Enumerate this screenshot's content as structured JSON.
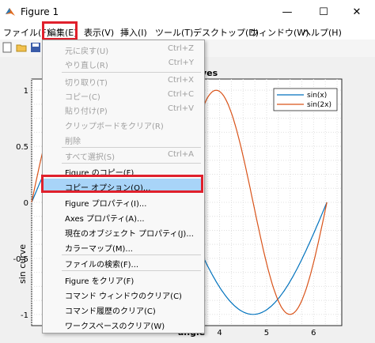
{
  "window": {
    "title": "Figure 1",
    "min_glyph": "—",
    "max_glyph": "☐",
    "close_glyph": "✕"
  },
  "menubar": [
    {
      "label": "ファイル(F)"
    },
    {
      "label": "編集(E)"
    },
    {
      "label": "表示(V)"
    },
    {
      "label": "挿入(I)"
    },
    {
      "label": "ツール(T)"
    },
    {
      "label": "デスクトップ(D)"
    },
    {
      "label": "ウィンドウ(W)"
    },
    {
      "label": "ヘルプ(H)"
    }
  ],
  "edit_menu": {
    "items": [
      {
        "label": "元に戻す(U)",
        "shortcut": "Ctrl+Z",
        "disabled": true
      },
      {
        "label": "やり直し(R)",
        "shortcut": "Ctrl+Y",
        "disabled": true
      },
      {
        "label": "切り取り(T)",
        "shortcut": "Ctrl+X",
        "disabled": true
      },
      {
        "label": "コピー(C)",
        "shortcut": "Ctrl+C",
        "disabled": true
      },
      {
        "label": "貼り付け(P)",
        "shortcut": "Ctrl+V",
        "disabled": true
      },
      {
        "label": "クリップボードをクリア(R)",
        "shortcut": "",
        "disabled": true
      },
      {
        "label": "削除",
        "shortcut": "",
        "disabled": true
      },
      {
        "label": "すべて選択(S)",
        "shortcut": "Ctrl+A",
        "disabled": true
      },
      {
        "label": "Figure のコピー(F)",
        "shortcut": "",
        "disabled": false
      },
      {
        "label": "コピー オプション(O)...",
        "shortcut": "",
        "disabled": false,
        "highlighted": true
      },
      {
        "label": "Figure プロパティ(I)...",
        "shortcut": "",
        "disabled": false
      },
      {
        "label": "Axes プロパティ(A)...",
        "shortcut": "",
        "disabled": false
      },
      {
        "label": "現在のオブジェクト プロパティ(J)...",
        "shortcut": "",
        "disabled": false
      },
      {
        "label": "カラーマップ(M)...",
        "shortcut": "",
        "disabled": false
      },
      {
        "label": "ファイルの検索(F)...",
        "shortcut": "",
        "disabled": false
      },
      {
        "label": "Figure をクリア(F)",
        "shortcut": "",
        "disabled": false
      },
      {
        "label": "コマンド ウィンドウのクリア(C)",
        "shortcut": "",
        "disabled": false
      },
      {
        "label": "コマンド履歴のクリア(C)",
        "shortcut": "",
        "disabled": false
      },
      {
        "label": "ワークスペースのクリア(W)",
        "shortcut": "",
        "disabled": false
      }
    ]
  },
  "chart_data": {
    "type": "line",
    "title_visible": "ves",
    "xlabel_visible": "angle",
    "ylabel": "sin curve",
    "x_ticks": [
      "4",
      "5",
      "6"
    ],
    "y_ticks": [
      "1",
      "0.5",
      "0",
      "-0.5",
      "-1"
    ],
    "grid": true,
    "legend_placement": "top-right",
    "series": [
      {
        "name": "sin(x)",
        "color": "#0072bd"
      },
      {
        "name": "sin(2x)",
        "color": "#d95319"
      }
    ]
  }
}
